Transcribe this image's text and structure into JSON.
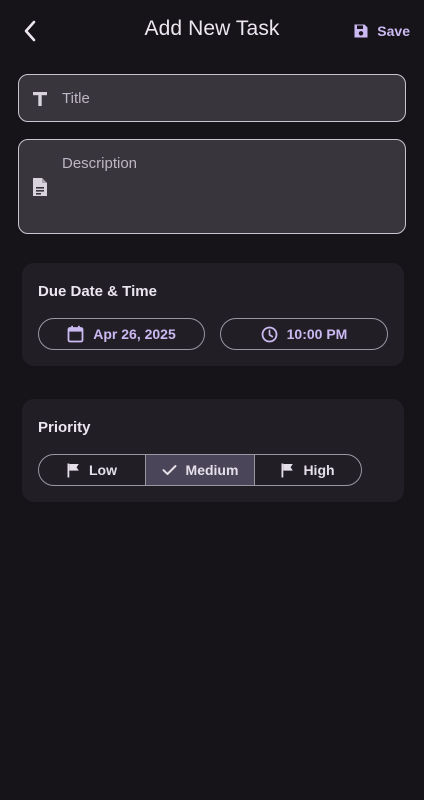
{
  "header": {
    "title": "Add New Task",
    "save_label": "Save"
  },
  "form": {
    "title_placeholder": "Title",
    "description_placeholder": "Description"
  },
  "due": {
    "heading": "Due Date & Time",
    "date": "Apr 26, 2025",
    "time": "10:00 PM"
  },
  "priority": {
    "heading": "Priority",
    "options": [
      {
        "label": "Low",
        "icon": "flag-icon",
        "selected": false
      },
      {
        "label": "Medium",
        "icon": "check-icon",
        "selected": true
      },
      {
        "label": "High",
        "icon": "flag-icon",
        "selected": false
      }
    ]
  },
  "colors": {
    "background": "#161319",
    "accent": "#cbbaf2",
    "card": "#211e25",
    "selected_segment": "#4b4559"
  },
  "icons": [
    "back-arrow-icon",
    "save-icon",
    "text-format-icon",
    "document-icon",
    "calendar-icon",
    "clock-icon",
    "flag-icon",
    "check-icon"
  ]
}
